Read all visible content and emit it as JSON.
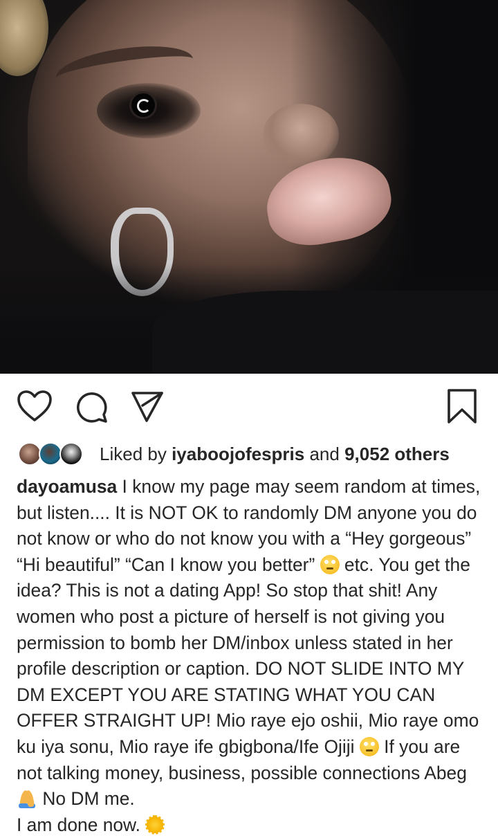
{
  "post": {
    "image_alt": "",
    "likes": {
      "prefix": "Liked by",
      "user": "iyaboojofespris",
      "middle": "and",
      "count": "9,052 others"
    },
    "caption": {
      "username": "dayoamusa",
      "part1": " I know my page may seem random at times, but listen.... It is NOT OK to randomly DM anyone you do not know or who do not know you with a “Hey gorgeous” “Hi beautiful” “Can I know you better” ",
      "part2": " etc. You get the idea? This is not a dating App! So stop that shit! Any women who post a picture of herself is not giving you permission to bomb her DM/inbox unless stated in her profile description or caption. DO NOT SLIDE INTO MY DM EXCEPT YOU ARE STATING WHAT YOU CAN OFFER STRAIGHT UP! Mio raye ejo oshii, Mio raye omo ku iya sonu, Mio raye ife gbigbona/Ife Ojiji ",
      "part3": " If you are not talking money, business, possible connections Abeg",
      "part4": " No DM me.",
      "part5": "I am done now. "
    },
    "icons": {
      "like": "heart-icon",
      "comment": "comment-icon",
      "share": "paper-plane-icon",
      "save": "bookmark-icon",
      "emoji1": "face-with-rolling-eyes-icon",
      "emoji2": "face-with-rolling-eyes-icon",
      "emoji3": "folded-hands-icon",
      "emoji4": "sun-icon"
    },
    "colors": {
      "text": "#262626",
      "background": "#ffffff"
    }
  }
}
